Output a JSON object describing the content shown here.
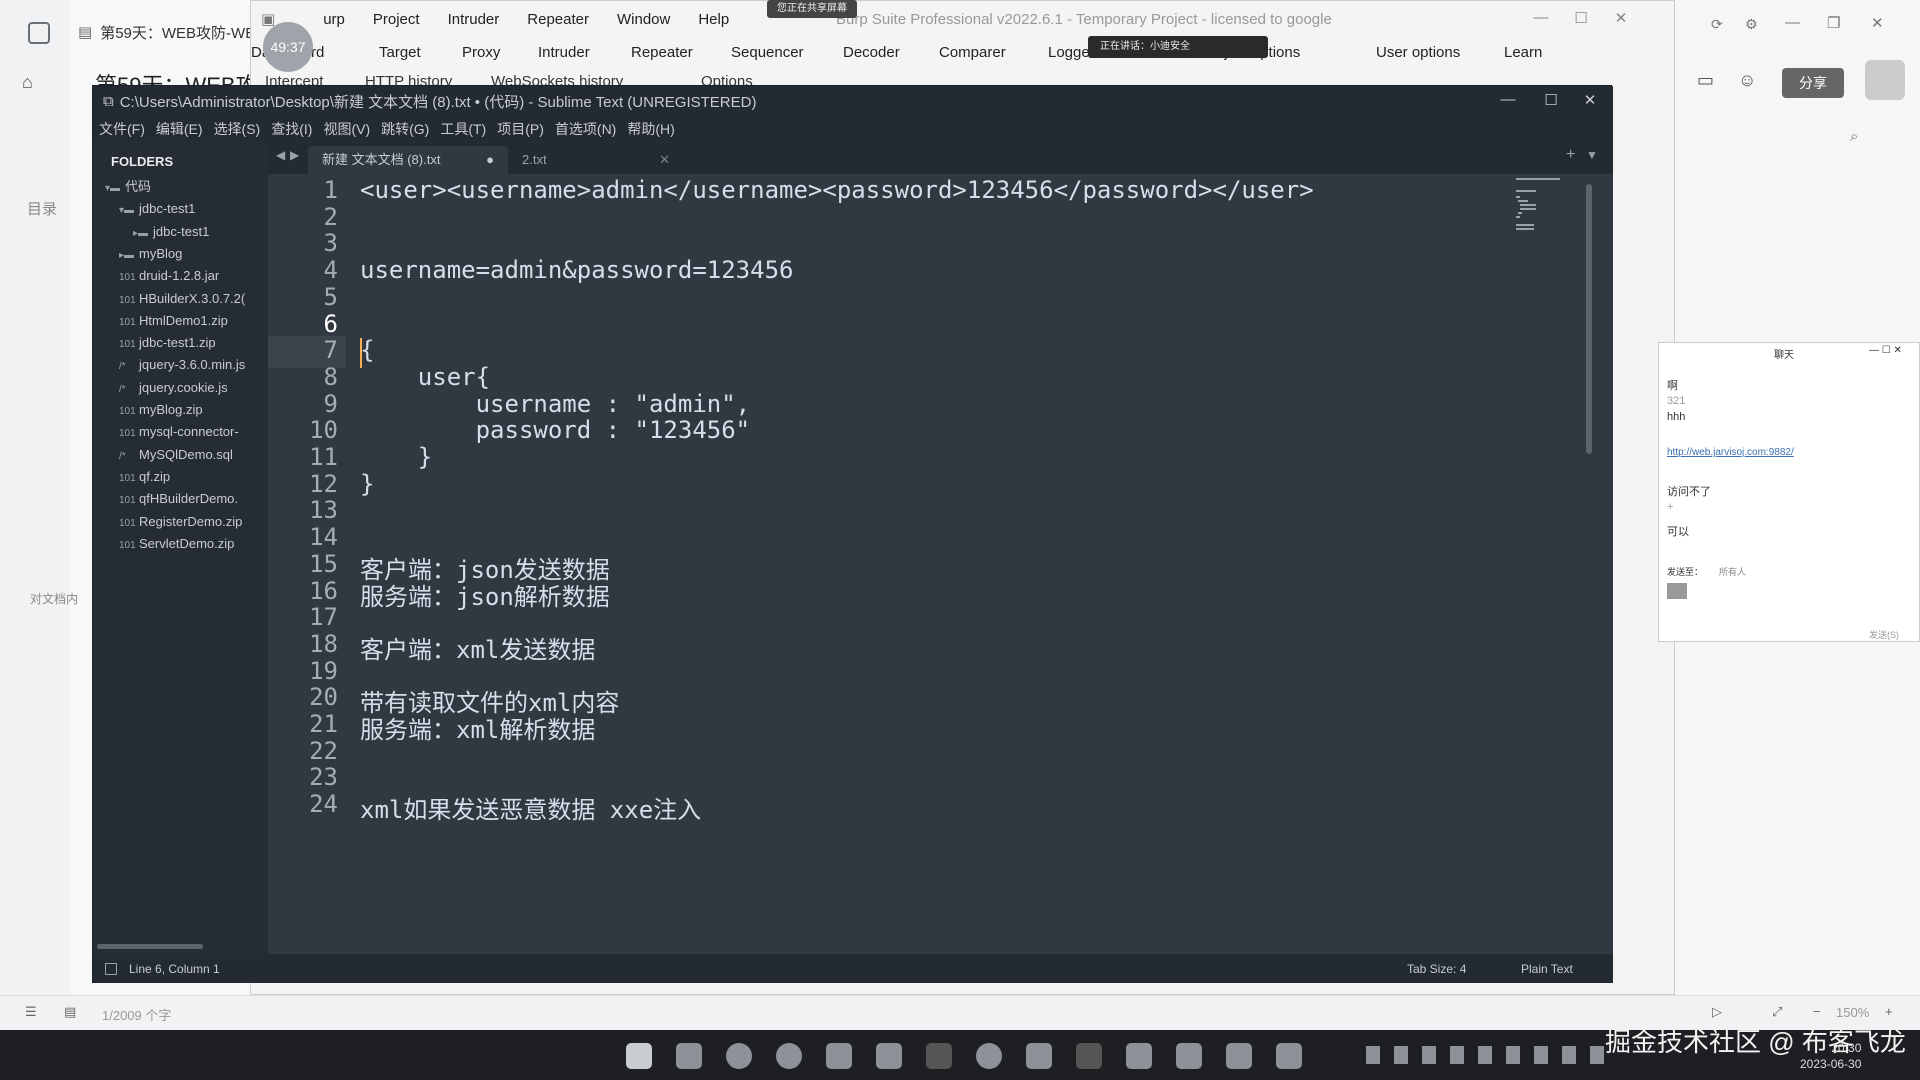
{
  "note_app": {
    "tab_title": "第59天：WEB攻防-WE",
    "heading": "第59天：WEB攻",
    "catalog_label": "目录",
    "side_note": "对文档内"
  },
  "burp": {
    "timer": "49:37",
    "recording_banner": "您正在共享屏幕",
    "title": "Burp Suite Professional v2022.6.1 - Temporary Project - licensed to google",
    "menu": [
      "urp",
      "Project",
      "Intruder",
      "Repeater",
      "Window",
      "Help"
    ],
    "tabs": [
      "Dashboard",
      "Target",
      "Proxy",
      "Intruder",
      "Repeater",
      "Sequencer",
      "Decoder",
      "Comparer",
      "Logger",
      "Project options",
      "User options",
      "Learn"
    ],
    "subtabs": [
      "Intercept",
      "HTTP history",
      "WebSockets history",
      "Options"
    ],
    "speaking_label": "正在讲话：小迪安全",
    "window_controls": [
      "—",
      "☐",
      "✕"
    ]
  },
  "right_app": {
    "share_label": "分享",
    "chat_title": "聊天",
    "chat_lines": [
      "啊",
      "321",
      "hhh",
      "http://web.jarvisoj.com:9882/",
      "访问不了",
      "+",
      "可以"
    ],
    "send_to_label": "发送至：",
    "send_to_value": "所有人",
    "send_button": "发送(S)"
  },
  "sublime": {
    "title": "C:\\Users\\Administrator\\Desktop\\新建 文本文档 (8).txt • (代码) - Sublime Text (UNREGISTERED)",
    "menu": [
      "文件(F)",
      "编辑(E)",
      "选择(S)",
      "查找(I)",
      "视图(V)",
      "跳转(G)",
      "工具(T)",
      "项目(P)",
      "首选项(N)",
      "帮助(H)"
    ],
    "sidebar": {
      "header": "FOLDERS",
      "items": [
        {
          "label": "代码",
          "kind": "folder-open",
          "level": 0
        },
        {
          "label": "jdbc-test1",
          "kind": "folder-open",
          "level": 1
        },
        {
          "label": "jdbc-test1",
          "kind": "folder",
          "level": 2
        },
        {
          "label": "myBlog",
          "kind": "folder",
          "level": 1
        },
        {
          "label": "druid-1.2.8.jar",
          "kind": "binary",
          "level": 1
        },
        {
          "label": "HBuilderX.3.0.7.2(",
          "kind": "binary",
          "level": 1
        },
        {
          "label": "HtmlDemo1.zip",
          "kind": "binary",
          "level": 1
        },
        {
          "label": "jdbc-test1.zip",
          "kind": "binary",
          "level": 1
        },
        {
          "label": "jquery-3.6.0.min.js",
          "kind": "script",
          "level": 1
        },
        {
          "label": "jquery.cookie.js",
          "kind": "script",
          "level": 1
        },
        {
          "label": "myBlog.zip",
          "kind": "binary",
          "level": 1
        },
        {
          "label": "mysql-connector-",
          "kind": "binary",
          "level": 1
        },
        {
          "label": "MySQlDemo.sql",
          "kind": "script",
          "level": 1
        },
        {
          "label": "qf.zip",
          "kind": "binary",
          "level": 1
        },
        {
          "label": "qfHBuilderDemo.",
          "kind": "binary",
          "level": 1
        },
        {
          "label": "RegisterDemo.zip",
          "kind": "binary",
          "level": 1
        },
        {
          "label": "ServletDemo.zip",
          "kind": "binary",
          "level": 1
        }
      ]
    },
    "tabs": [
      {
        "label": "新建 文本文档 (8).txt",
        "active": true,
        "modified": true
      },
      {
        "label": "2.txt",
        "active": false,
        "modified": false
      }
    ],
    "lines": [
      "<user><username>admin</username><password>123456</password></user>",
      "",
      "",
      "username=admin&password=123456",
      "",
      "",
      "{",
      "    user{",
      "        username : \"admin\",",
      "        password : \"123456\"",
      "    }",
      "}",
      "",
      "",
      "客户端：json发送数据",
      "服务端：json解析数据",
      "",
      "客户端：xml发送数据",
      "",
      "带有读取文件的xml内容",
      "服务端：xml解析数据",
      "",
      "",
      "xml如果发送恶意数据 xxe注入"
    ],
    "cursor_line": 6,
    "status": {
      "position": "Line 6, Column 1",
      "tab_size": "Tab Size: 4",
      "syntax": "Plain Text"
    }
  },
  "note_bottom": {
    "word_count": "1/2009 个字",
    "zoom": "150%"
  },
  "taskbar": {
    "watermark": "掘金技术社区 @ 布客飞龙",
    "time": "20:30",
    "date": "2023-06-30"
  }
}
